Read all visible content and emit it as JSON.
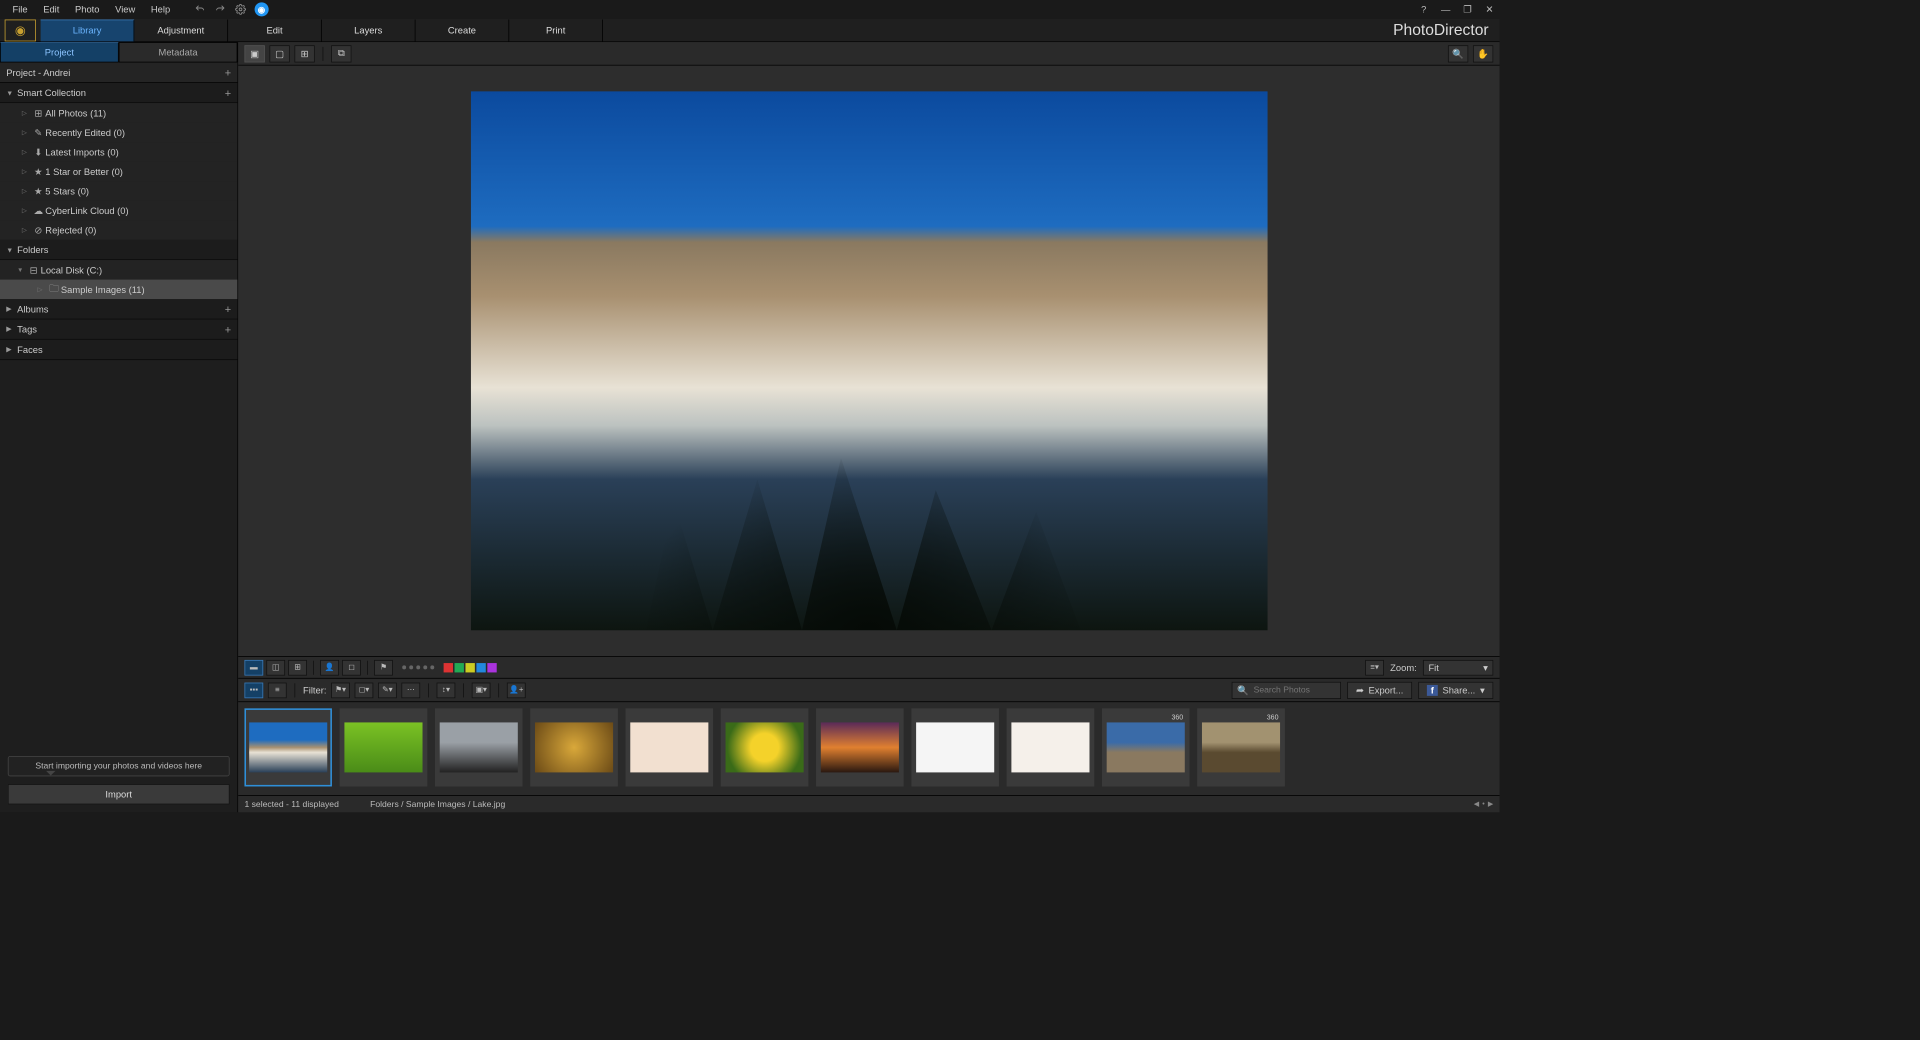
{
  "app_name": "PhotoDirector",
  "menubar": {
    "items": [
      "File",
      "Edit",
      "Photo",
      "View",
      "Help"
    ]
  },
  "modules": [
    "Library",
    "Adjustment",
    "Edit",
    "Layers",
    "Create",
    "Print"
  ],
  "active_module": 0,
  "side_tabs": [
    "Project",
    "Metadata"
  ],
  "active_side_tab": 0,
  "project_header": "Project - Andrei",
  "tree": {
    "smart_collection_label": "Smart Collection",
    "smart_items": [
      {
        "label": "All Photos (11)"
      },
      {
        "label": "Recently Edited (0)"
      },
      {
        "label": "Latest Imports (0)"
      },
      {
        "label": "1 Star or Better (0)"
      },
      {
        "label": "5 Stars (0)"
      },
      {
        "label": "CyberLink Cloud (0)"
      },
      {
        "label": "Rejected (0)"
      }
    ],
    "folders_label": "Folders",
    "folder_root": "Local Disk (C:)",
    "folder_child": "Sample Images (11)",
    "albums_label": "Albums",
    "tags_label": "Tags",
    "faces_label": "Faces"
  },
  "import_hint": "Start importing your photos and videos here",
  "import_button": "Import",
  "filter_label": "Filter:",
  "zoom_label": "Zoom:",
  "zoom_value": "Fit",
  "search_placeholder": "Search Photos",
  "export_label": "Export...",
  "share_label": "Share...",
  "status": {
    "selection": "1 selected - 11 displayed",
    "path": "Folders / Sample Images / Lake.jpg"
  },
  "color_swatches": [
    "#d33",
    "#2a5",
    "#cc2",
    "#28d",
    "#a3d"
  ],
  "thumbs": [
    {
      "bg": "linear-gradient(#1e6cc0 35%,#a89070 50%,#e8e2d5 60%,#2a4058 100%)",
      "selected": true
    },
    {
      "bg": "linear-gradient(#7bc224,#4a8c18)"
    },
    {
      "bg": "linear-gradient(#9aa0a6 40%,#222 100%)"
    },
    {
      "bg": "radial-gradient(circle,#d9a83a,#6b4a16)"
    },
    {
      "bg": "#f2e0d0"
    },
    {
      "bg": "radial-gradient(circle,#f4d22a 30%,#3a6b18 80%)"
    },
    {
      "bg": "linear-gradient(#5a2a58,#e08030 50%,#2a1810)"
    },
    {
      "bg": "#f5f5f5"
    },
    {
      "bg": "#f5f0ea"
    },
    {
      "bg": "linear-gradient(#3a6ba8 40%,#8a7960 60%)",
      "is360": true
    },
    {
      "bg": "linear-gradient(#a29270 40%,#5a4a30 60%)",
      "is360": true
    }
  ],
  "badge_360": "360"
}
